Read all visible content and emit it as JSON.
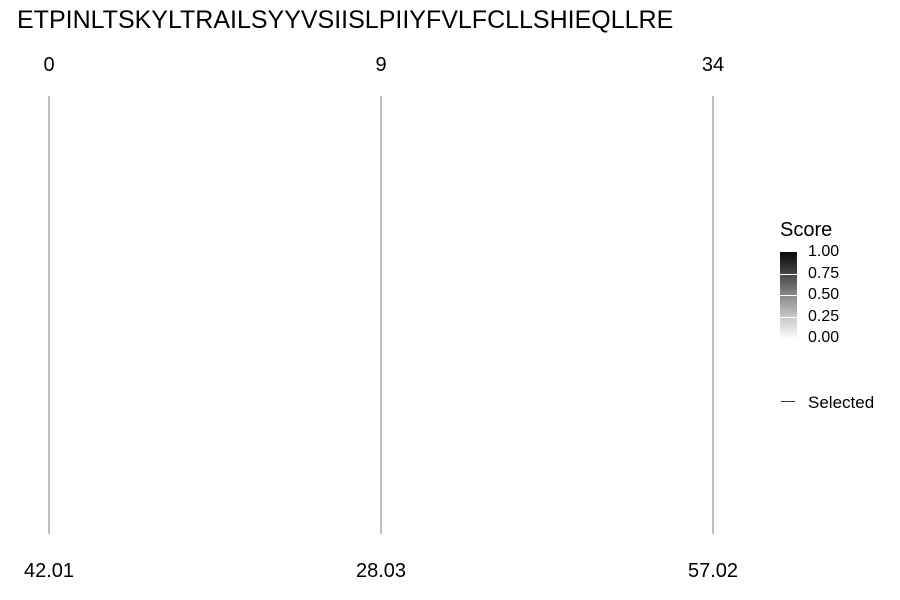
{
  "chart_data": {
    "type": "line",
    "title": "ETPINLTSKYLTRAILSYYVSIISLPIIYFVLFCLLSHIEQLLRE",
    "top_labels": [
      "0",
      "9",
      "34"
    ],
    "bottom_labels": [
      "42.01",
      "28.03",
      "57.02"
    ],
    "legend": {
      "title": "Score",
      "range": [
        0,
        1
      ],
      "ticks": [
        "1.00",
        "0.75",
        "0.50",
        "0.25",
        "0.00"
      ],
      "line_label": "Selected",
      "placement": "right"
    },
    "colors": {
      "line": "#7f7f7f",
      "scale_high": "#0a0a0a",
      "scale_low": "#fbfbfb"
    }
  }
}
